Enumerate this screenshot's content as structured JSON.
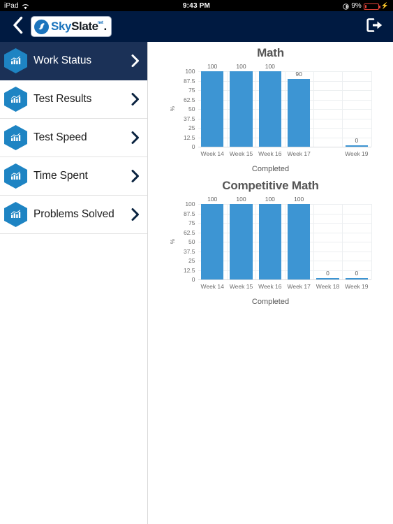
{
  "status_bar": {
    "device": "iPad",
    "wifi_icon": "wifi-icon",
    "time": "9:43 PM",
    "lock_icon": "rotation-lock-icon",
    "battery_percent": "9%",
    "charging_icon": "lightning-bolt-icon"
  },
  "navbar": {
    "back_icon": "chevron-left-icon",
    "logo": {
      "mark_icon": "skyslate-swirl-icon",
      "sky": "Sky",
      "slate": "Slate",
      "dot": ".",
      "net": "net"
    },
    "exit_icon": "logout-icon",
    "background": "#001a41"
  },
  "sidebar": {
    "items": [
      {
        "label": "Work Status",
        "icon": "bar-chart-icon",
        "active": true
      },
      {
        "label": "Test Results",
        "icon": "bar-chart-icon",
        "active": false
      },
      {
        "label": "Test Speed",
        "icon": "bar-chart-icon",
        "active": false
      },
      {
        "label": "Time Spent",
        "icon": "bar-chart-icon",
        "active": false
      },
      {
        "label": "Problems Solved",
        "icon": "bar-chart-icon",
        "active": false
      }
    ],
    "chevron_icon": "chevron-right-icon",
    "active_background": "#1b3157",
    "hex_color": "#1e84c3"
  },
  "chart_data": [
    {
      "type": "bar",
      "title": "Math",
      "xlabel": "Completed",
      "ylabel": "%",
      "categories": [
        "Week 14",
        "Week 15",
        "Week 16",
        "Week 17",
        "Week 19"
      ],
      "values": [
        100,
        100,
        100,
        90,
        0
      ],
      "value_labels": [
        "100",
        "100",
        "100",
        "90",
        "0"
      ],
      "yticks": [
        100,
        87.5,
        75,
        62.5,
        50,
        37.5,
        25,
        12.5,
        0
      ],
      "ytick_labels": [
        "100",
        "87.5",
        "75",
        "62.5",
        "50",
        "37.5",
        "25",
        "12.5",
        "0"
      ],
      "ylim": [
        0,
        100
      ],
      "grid": true,
      "legend": false,
      "bar_color": "#3d95d3"
    },
    {
      "type": "bar",
      "title": "Competitive Math",
      "xlabel": "Completed",
      "ylabel": "%",
      "categories": [
        "Week 14",
        "Week 15",
        "Week 16",
        "Week 17",
        "Week 18",
        "Week 19"
      ],
      "values": [
        100,
        100,
        100,
        100,
        0,
        0
      ],
      "value_labels": [
        "100",
        "100",
        "100",
        "100",
        "0",
        "0"
      ],
      "yticks": [
        100,
        87.5,
        75,
        62.5,
        50,
        37.5,
        25,
        12.5,
        0
      ],
      "ytick_labels": [
        "100",
        "87.5",
        "75",
        "62.5",
        "50",
        "37.5",
        "25",
        "12.5",
        "0"
      ],
      "ylim": [
        0,
        100
      ],
      "grid": true,
      "legend": false,
      "bar_color": "#3d95d3"
    }
  ]
}
